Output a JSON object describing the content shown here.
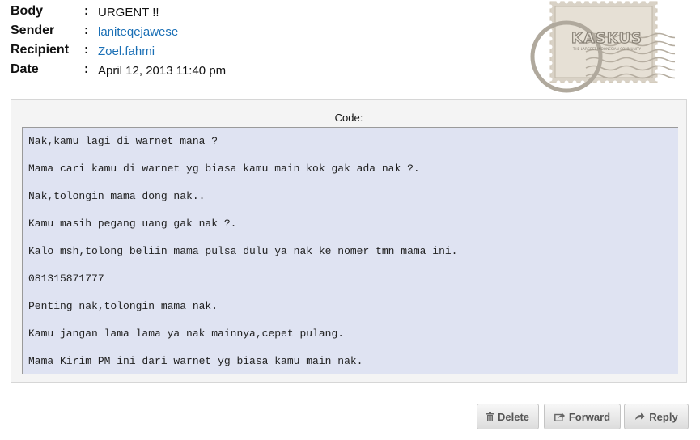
{
  "message": {
    "fields": [
      {
        "label": "Body",
        "value": "URGENT !!"
      },
      {
        "label": "Sender",
        "value": "laniteqejawese"
      },
      {
        "label": "Recipient",
        "value": "Zoel.fahmi"
      },
      {
        "label": "Date",
        "value": "April 12, 2013 11:40 pm"
      }
    ],
    "separator": ":"
  },
  "stamp": {
    "logo_text": "KASKUS",
    "tagline": "THE LARGEST INDONESIAN COMMUNITY"
  },
  "code": {
    "title": "Code:",
    "lines": [
      "Nak,kamu lagi di warnet mana ?",
      "Mama cari kamu di warnet yg biasa kamu main kok gak ada nak ?.",
      "Nak,tolongin mama dong nak..",
      "Kamu masih pegang uang gak nak ?.",
      "Kalo msh,tolong beliin mama pulsa dulu ya nak ke nomer tmn mama ini.",
      "081315871777",
      "Penting nak,tolongin mama nak.",
      "Kamu jangan lama lama ya nak mainnya,cepet pulang.",
      "Mama Kirim PM ini dari warnet yg biasa kamu main nak."
    ]
  },
  "actions": {
    "delete_label": "Delete",
    "forward_label": "Forward",
    "reply_label": "Reply"
  },
  "colors": {
    "link": "#1a6fb5",
    "code_background": "#dfe3f2",
    "panel_background": "#f4f4f4"
  }
}
